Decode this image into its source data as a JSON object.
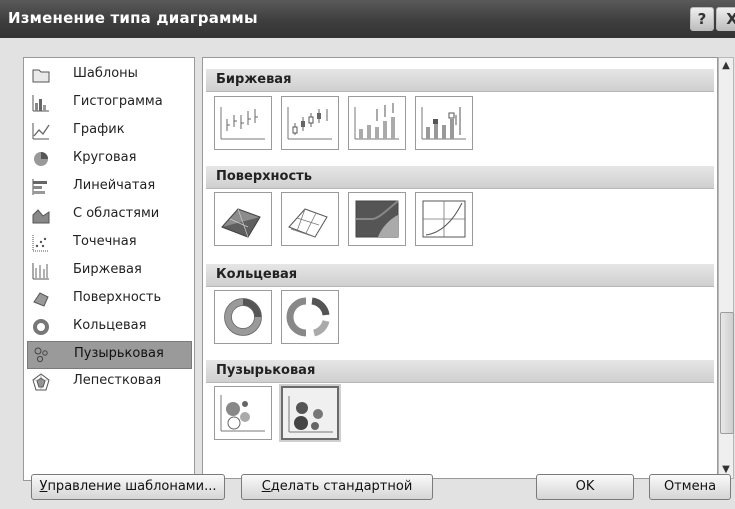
{
  "dialog": {
    "title": "Изменение типа диаграммы"
  },
  "titlebar": {
    "help_label": "?",
    "close_label": "X"
  },
  "left_list": {
    "items": [
      {
        "label": "Шаблоны",
        "icon": "folder-icon"
      },
      {
        "label": "Гистограмма",
        "icon": "column-chart-icon"
      },
      {
        "label": "График",
        "icon": "line-chart-icon"
      },
      {
        "label": "Круговая",
        "icon": "pie-chart-icon"
      },
      {
        "label": "Линейчатая",
        "icon": "bar-chart-icon"
      },
      {
        "label": "С областями",
        "icon": "area-chart-icon"
      },
      {
        "label": "Точечная",
        "icon": "scatter-chart-icon"
      },
      {
        "label": "Биржевая",
        "icon": "stock-chart-icon"
      },
      {
        "label": "Поверхность",
        "icon": "surface-chart-icon"
      },
      {
        "label": "Кольцевая",
        "icon": "doughnut-chart-icon"
      },
      {
        "label": "Пузырьковая",
        "icon": "bubble-chart-icon",
        "selected": true
      },
      {
        "label": "Лепестковая",
        "icon": "radar-chart-icon"
      }
    ]
  },
  "sections": {
    "stock": "Биржевая",
    "surface": "Поверхность",
    "doughnut": "Кольцевая",
    "bubble": "Пузырьковая"
  },
  "buttons": {
    "manage_templates": "Управление шаблонами...",
    "manage_templates_key": "У",
    "manage_templates_rest": "правление шаблонами...",
    "set_default_key": "С",
    "set_default_rest": "делать стандартной",
    "ok": "OK",
    "cancel": "Отмена"
  }
}
